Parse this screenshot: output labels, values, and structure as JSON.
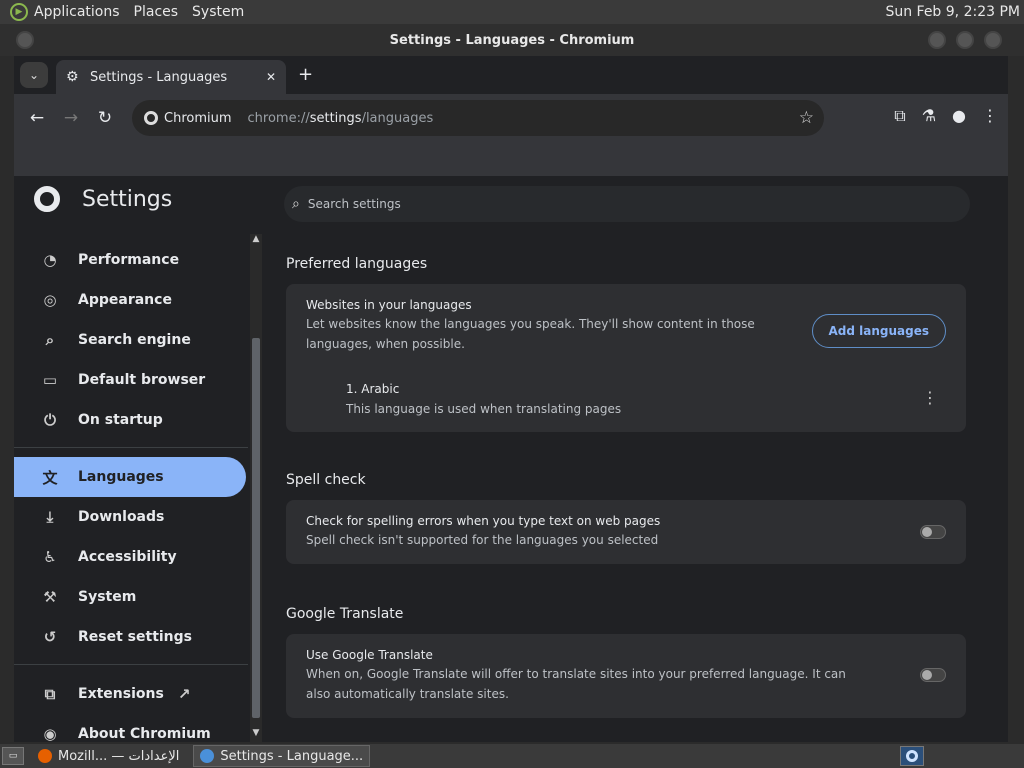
{
  "desktop": {
    "menus": [
      "Applications",
      "Places",
      "System"
    ],
    "clock": "Sun Feb  9,  2:23 PM"
  },
  "window": {
    "title": "Settings - Languages - Chromium"
  },
  "browser": {
    "tab_title": "Settings - Languages",
    "chip_label": "Chromium",
    "url_prefix": "chrome://",
    "url_host": "settings",
    "url_path": "/languages"
  },
  "settings": {
    "title": "Settings",
    "search_placeholder": "Search settings",
    "sidebar": [
      {
        "label": "Performance",
        "icon": "gauge-icon"
      },
      {
        "label": "Appearance",
        "icon": "palette-icon"
      },
      {
        "label": "Search engine",
        "icon": "search-icon"
      },
      {
        "label": "Default browser",
        "icon": "browser-icon"
      },
      {
        "label": "On startup",
        "icon": "power-icon"
      },
      {
        "label": "Languages",
        "icon": "translate-icon"
      },
      {
        "label": "Downloads",
        "icon": "download-icon"
      },
      {
        "label": "Accessibility",
        "icon": "accessibility-icon"
      },
      {
        "label": "System",
        "icon": "wrench-icon"
      },
      {
        "label": "Reset settings",
        "icon": "reset-icon"
      },
      {
        "label": "Extensions",
        "icon": "puzzle-icon"
      },
      {
        "label": "About Chromium",
        "icon": "chromium-icon"
      }
    ],
    "preferred": {
      "title": "Preferred languages",
      "row_title": "Websites in your languages",
      "row_sub": "Let websites know the languages you speak. They'll show content in those languages, when possible.",
      "add_button": "Add languages",
      "lang_name": "1. Arabic",
      "lang_sub": "This language is used when translating pages"
    },
    "spell": {
      "title": "Spell check",
      "row_title": "Check for spelling errors when you type text on web pages",
      "row_sub": "Spell check isn't supported for the languages you selected"
    },
    "translate": {
      "title": "Google Translate",
      "row_title": "Use Google Translate",
      "row_sub": "When on, Google Translate will offer to translate sites into your preferred language. It can also automatically translate sites."
    }
  },
  "taskbar": {
    "task1": "Mozill... — الإعدادات",
    "task2": "Settings - Language..."
  }
}
